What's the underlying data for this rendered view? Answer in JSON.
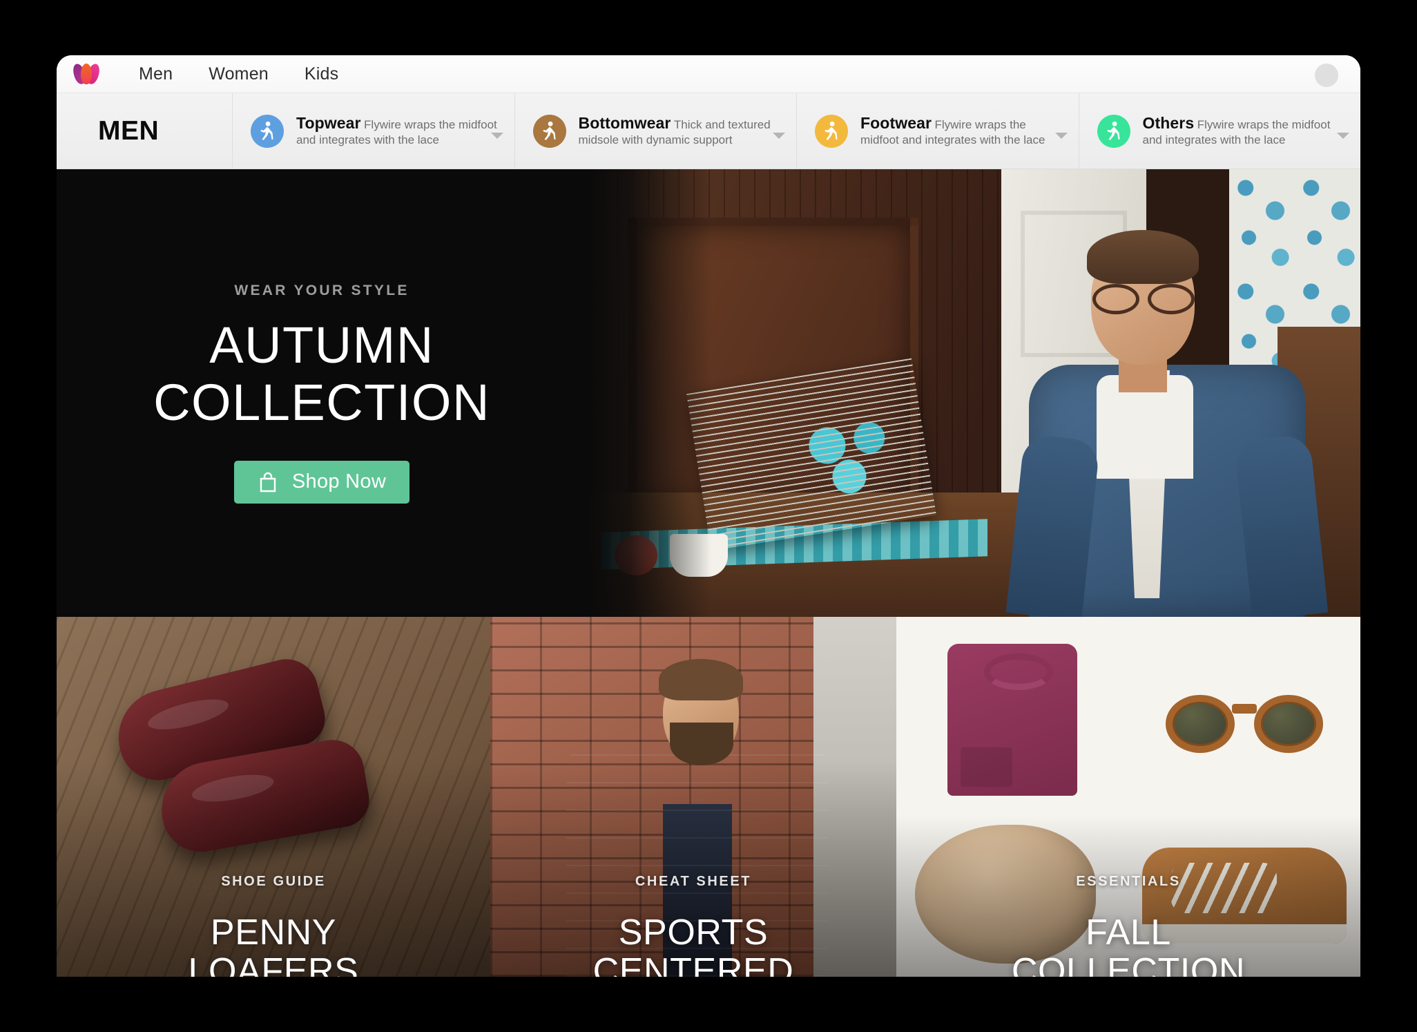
{
  "topbar": {
    "logo_name": "myntra-logo",
    "links": [
      {
        "label": "Men"
      },
      {
        "label": "Women"
      },
      {
        "label": "Kids"
      }
    ],
    "avatar_name": "user-avatar"
  },
  "catnav": {
    "section_label": "MEN",
    "categories": [
      {
        "title": "Topwear",
        "desc": "Flywire wraps the midfoot and integrates with the lace",
        "color": "#5e9fe0",
        "icon": "walking-person-icon"
      },
      {
        "title": "Bottomwear",
        "desc": "Thick and textured midsole with dynamic support",
        "color": "#a9773f",
        "icon": "walking-person-icon"
      },
      {
        "title": "Footwear",
        "desc": "Flywire wraps the midfoot and integrates with the lace",
        "color": "#f2b93d",
        "icon": "walking-person-icon"
      },
      {
        "title": "Others",
        "desc": "Flywire wraps the midfoot and integrates with the lace",
        "color": "#38e49a",
        "icon": "walking-person-icon"
      }
    ]
  },
  "hero": {
    "kicker": "WEAR YOUR STYLE",
    "title_line1": "AUTUMN",
    "title_line2": "COLLECTION",
    "cta_label": "Shop Now",
    "cta_icon": "shopping-bag-icon",
    "cta_color": "#5fc596",
    "background_color": "#0a0a0a",
    "photo_alt": "man-reading-newspaper-photo"
  },
  "cards": [
    {
      "kicker": "SHOE GUIDE",
      "title_line1": "PENNY",
      "title_line2": "LOAFERS",
      "image_alt": "penny-loafers-photo"
    },
    {
      "kicker": "CHEAT SHEET",
      "title_line1": "SPORTS",
      "title_line2": "CENTERED",
      "image_alt": "man-in-puffer-jacket-photo"
    },
    {
      "kicker": "ESSENTIALS",
      "title_line1": "FALL",
      "title_line2": "COLLECTION",
      "image_alt": "fall-essentials-grid-photo"
    }
  ]
}
